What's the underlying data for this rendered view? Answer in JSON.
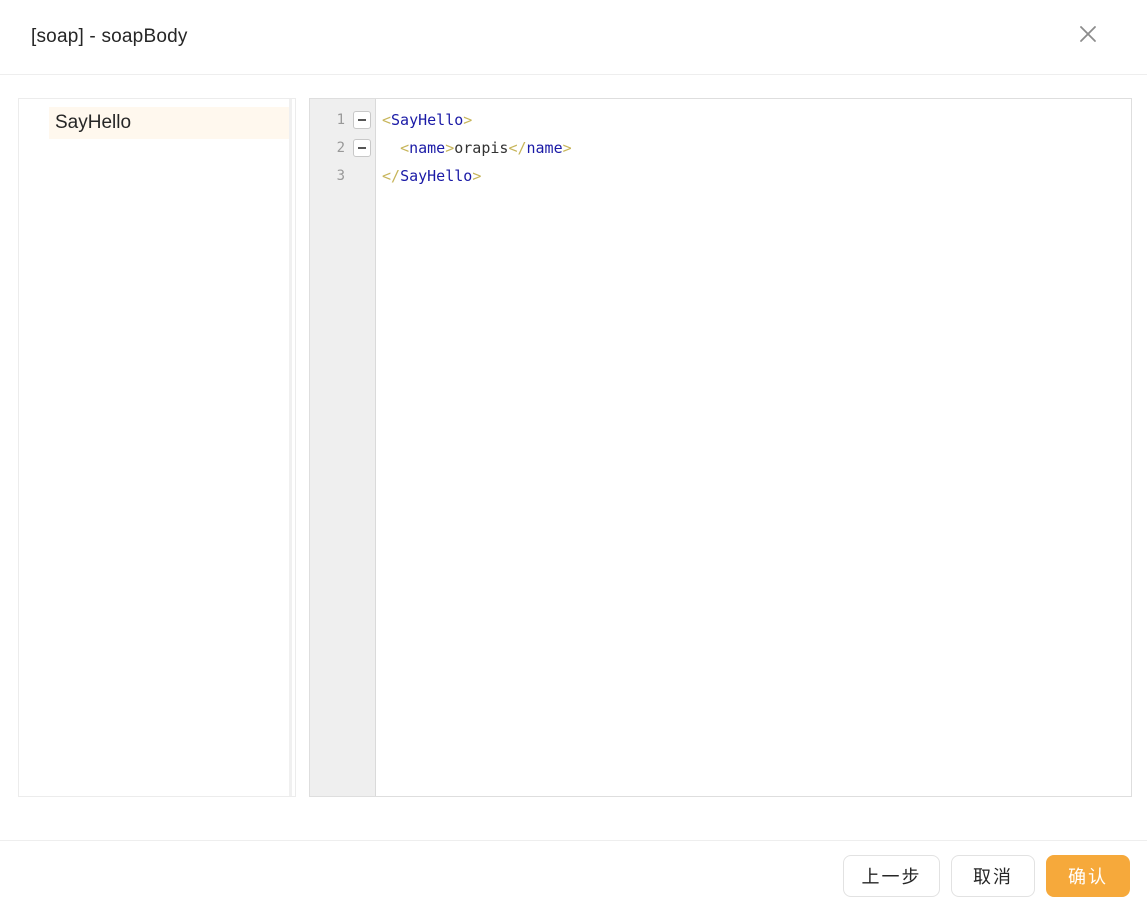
{
  "dialog": {
    "title": "[soap] - soapBody",
    "close_icon": "close-icon"
  },
  "tree": {
    "nodes": [
      {
        "label": "SayHello",
        "selected": true
      }
    ]
  },
  "editor": {
    "lines": [
      {
        "number": "1",
        "foldable": true
      },
      {
        "number": "2",
        "foldable": true
      },
      {
        "number": "3",
        "foldable": false
      }
    ],
    "code": {
      "line1_tag": "SayHello",
      "line2_tag_open": "name",
      "line2_text": "orapis",
      "line2_tag_close": "name",
      "line3_tag": "SayHello"
    }
  },
  "footer": {
    "prev_label": "上一步",
    "cancel_label": "取消",
    "ok_label": "确认",
    "accent_color": "#f6a93b"
  }
}
